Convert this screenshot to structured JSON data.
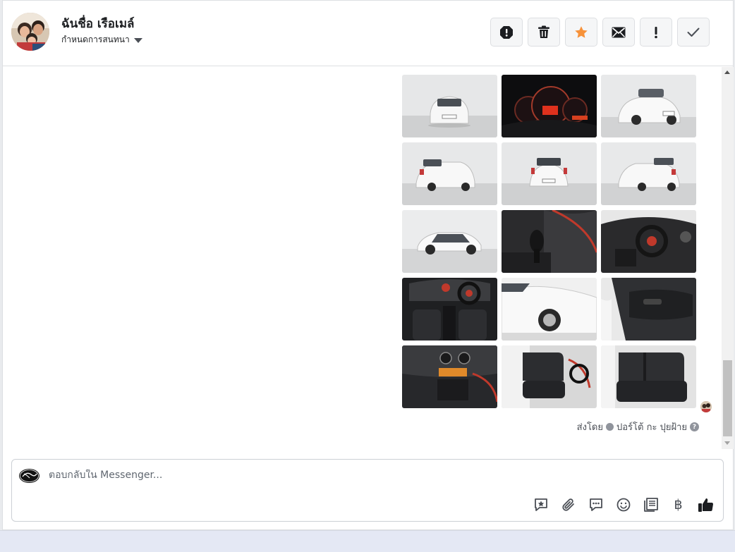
{
  "header": {
    "contact_name": "ฉันชื่อ เรือเมล์",
    "conversation_settings_label": "กำหนดการสนทนา"
  },
  "toolbar": {
    "buttons": [
      "spam-icon",
      "trash-icon",
      "star-icon",
      "envelope-icon",
      "exclamation-icon",
      "check-icon"
    ],
    "star_color": "#f7923a"
  },
  "messages": {
    "photos": [
      "car-front-white",
      "dashboard-gauges",
      "car-front-angle",
      "car-rear-left",
      "car-rear",
      "car-rear-right",
      "car-side",
      "gear-shifter",
      "interior-dashboard",
      "interior-overview",
      "car-front-wheel",
      "door-panel",
      "center-console",
      "front-seats",
      "rear-seats"
    ],
    "sent_by_prefix": "ส่งโดย",
    "sent_by_name": "ปอร์โต้ กะ ปุยฝ้าย"
  },
  "composer": {
    "placeholder": "ตอบกลับใน Messenger...",
    "tools": [
      "saved-reply-icon",
      "attachment-icon",
      "chat-bubble-icon",
      "emoji-icon",
      "catalog-icon",
      "baht-icon",
      "like-icon"
    ],
    "currency_symbol": "฿"
  }
}
